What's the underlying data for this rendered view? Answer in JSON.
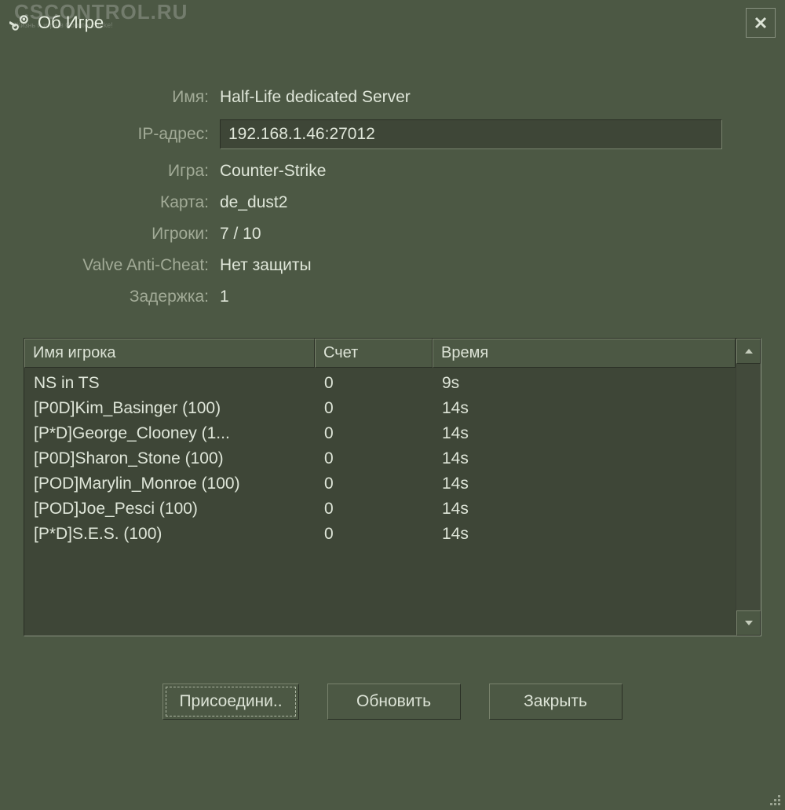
{
  "window": {
    "title": "Об Игре"
  },
  "watermark": {
    "text": "CSCONTROL.RU",
    "subtitle": "Жизнь и игра в Counter-Strike!"
  },
  "info": {
    "name_label": "Имя:",
    "name_value": "Half-Life dedicated Server",
    "ip_label": "IP-адрес:",
    "ip_value": "192.168.1.46:27012",
    "game_label": "Игра:",
    "game_value": "Counter-Strike",
    "map_label": "Карта:",
    "map_value": "de_dust2",
    "players_label": "Игроки:",
    "players_value": "7 / 10",
    "vac_label": "Valve Anti-Cheat:",
    "vac_value": "Нет защиты",
    "latency_label": "Задержка:",
    "latency_value": "1"
  },
  "player_table": {
    "headers": {
      "name": "Имя игрока",
      "score": "Счет",
      "time": "Время"
    },
    "rows": [
      {
        "name": "NS in TS",
        "score": "0",
        "time": "9s"
      },
      {
        "name": "[P0D]Kim_Basinger (100)",
        "score": "0",
        "time": "14s"
      },
      {
        "name": "[P*D]George_Clooney (1...",
        "score": "0",
        "time": "14s"
      },
      {
        "name": "[P0D]Sharon_Stone (100)",
        "score": "0",
        "time": "14s"
      },
      {
        "name": "[POD]Marylin_Monroe (100)",
        "score": "0",
        "time": "14s"
      },
      {
        "name": "[POD]Joe_Pesci (100)",
        "score": "0",
        "time": "14s"
      },
      {
        "name": "[P*D]S.E.S. (100)",
        "score": "0",
        "time": "14s"
      }
    ]
  },
  "buttons": {
    "join": "Присоедини..",
    "refresh": "Обновить",
    "close": "Закрыть"
  }
}
